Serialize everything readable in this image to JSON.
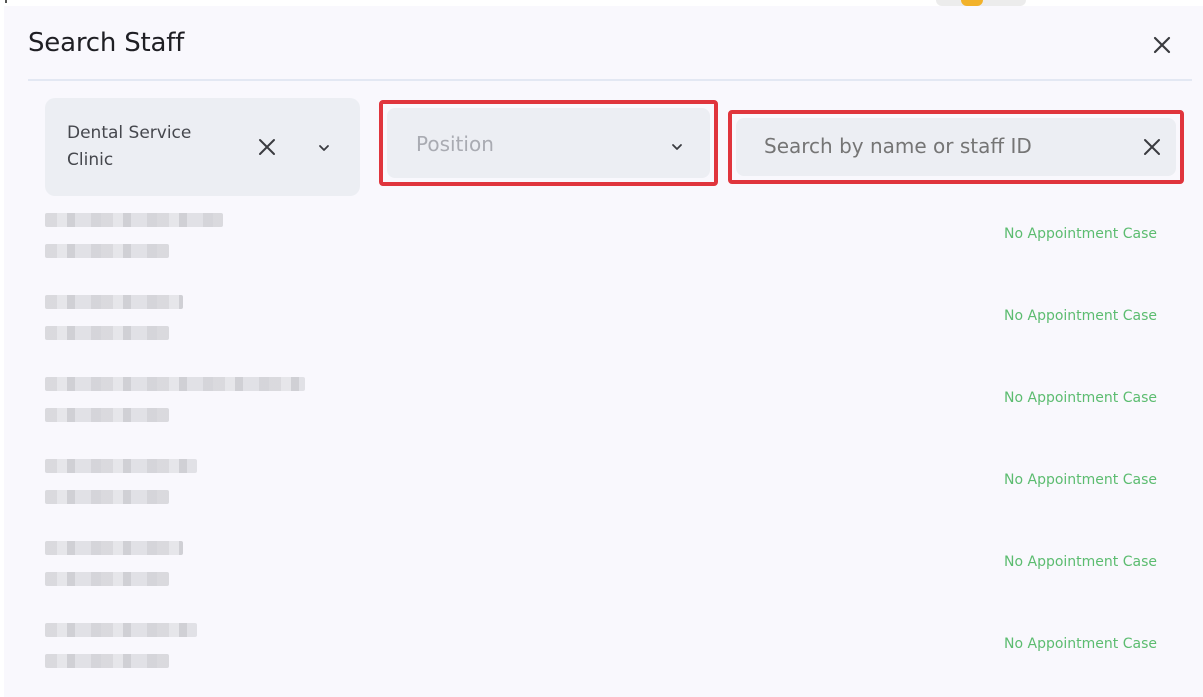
{
  "dialog": {
    "title": "Search Staff",
    "close_icon": "close-icon"
  },
  "filters": {
    "clinic": {
      "value": "Dental Service Clinic",
      "clear_icon": "close-icon",
      "dropdown_icon": "chevron-down-icon"
    },
    "position": {
      "placeholder": "Position",
      "dropdown_icon": "chevron-down-icon"
    },
    "search": {
      "placeholder": "Search by name or staff ID",
      "clear_icon": "close-icon"
    }
  },
  "staff_list": [
    {
      "status": "No Appointment Case"
    },
    {
      "status": "No Appointment Case"
    },
    {
      "status": "No Appointment Case"
    },
    {
      "status": "No Appointment Case"
    },
    {
      "status": "No Appointment Case"
    },
    {
      "status": "No Appointment Case"
    }
  ],
  "colors": {
    "highlight": "#e0353d",
    "status_text": "#5cbc70",
    "field_bg": "#eceef3"
  }
}
